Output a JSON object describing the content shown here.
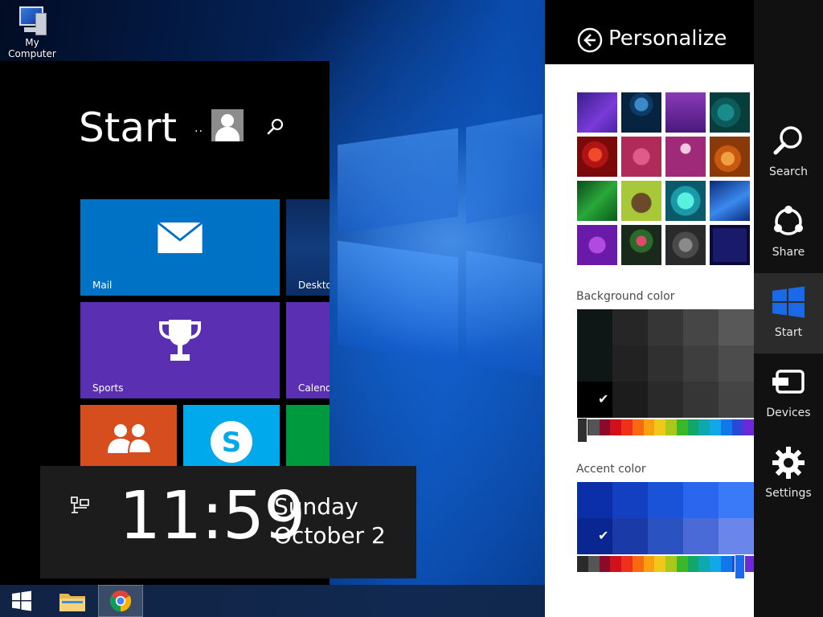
{
  "desktop": {
    "icon_label": "My Computer"
  },
  "start_screen": {
    "title": "Start",
    "user_dots": "..",
    "tiles": {
      "mail": "Mail",
      "desktop": "Desktop",
      "sports": "Sports",
      "calendar": "Calendar"
    }
  },
  "clock": {
    "time": "11:59",
    "day": "Sunday",
    "date": "October 2"
  },
  "personalize": {
    "title": "Personalize",
    "background_color_label": "Background color",
    "accent_color_label": "Accent color"
  },
  "charms": {
    "search": "Search",
    "share": "Share",
    "start": "Start",
    "devices": "Devices",
    "settings": "Settings"
  },
  "colors": {
    "mail_tile": "#0072c6",
    "sports_tile": "#5b2fb2",
    "people_tile": "#d64d1e",
    "skype_tile": "#00a9ec",
    "green_tile": "#009a3e",
    "accent_selected": "#0a2fa8",
    "background_selected": "#000000"
  },
  "icons": {
    "back": "back-arrow-icon",
    "search": "search-icon",
    "share": "share-icon",
    "start": "windows-logo-icon",
    "devices": "devices-icon",
    "settings": "gear-icon"
  }
}
